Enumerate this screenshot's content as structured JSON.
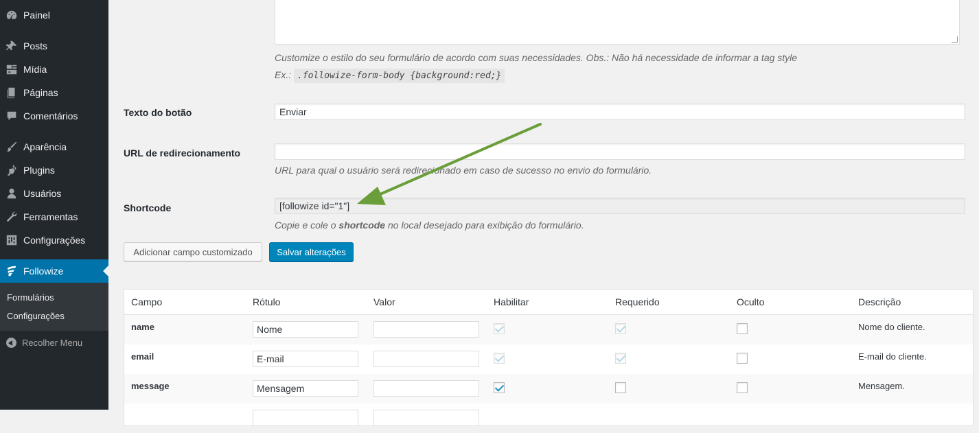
{
  "sidebar": {
    "menu": [
      {
        "label": "Painel",
        "icon": "dashboard-icon"
      },
      {
        "label": "Posts",
        "icon": "pin-icon"
      },
      {
        "label": "Mídia",
        "icon": "media-icon"
      },
      {
        "label": "Páginas",
        "icon": "pages-icon"
      },
      {
        "label": "Comentários",
        "icon": "comments-icon"
      },
      {
        "label": "Aparência",
        "icon": "brush-icon"
      },
      {
        "label": "Plugins",
        "icon": "plugin-icon"
      },
      {
        "label": "Usuários",
        "icon": "users-icon"
      },
      {
        "label": "Ferramentas",
        "icon": "wrench-icon"
      },
      {
        "label": "Configurações",
        "icon": "settings-icon"
      },
      {
        "label": "Followize",
        "icon": "followize-icon"
      }
    ],
    "submenu": [
      "Formulários",
      "Configurações"
    ],
    "collapse_label": "Recolher Menu",
    "accent_color": "#0073aa",
    "bg_color": "#23282d"
  },
  "form": {
    "css_help": "Customize o estilo do seu formulário de acordo com suas necessidades. Obs.: Não há necessidade de informar a tag style",
    "css_example_prefix": "Ex.:",
    "css_example_code": ".followize-form-body {background:red;}",
    "button_text_label": "Texto do botão",
    "button_text_value": "Enviar",
    "redirect_label": "URL de redirecionamento",
    "redirect_value": "",
    "redirect_help": "URL para qual o usuário será redirecionado em caso de sucesso no envio do formulário.",
    "shortcode_label": "Shortcode",
    "shortcode_value": "[followize id=\"1\"]",
    "shortcode_help_before": "Copie e cole o",
    "shortcode_help_bold": "shortcode",
    "shortcode_help_after": "no local desejado para exibição do formulário."
  },
  "buttons": {
    "add_custom_field": "Adicionar campo customizado",
    "save_changes": "Salvar alterações"
  },
  "table": {
    "headers": [
      "Campo",
      "Rótulo",
      "Valor",
      "Habilitar",
      "Requerido",
      "Oculto",
      "Descrição"
    ],
    "rows": [
      {
        "campo": "name",
        "rotulo": "Nome",
        "valor": "",
        "habilitar": true,
        "habilitar_disabled": true,
        "requerido": true,
        "requerido_disabled": true,
        "oculto": false,
        "descricao": "Nome do cliente."
      },
      {
        "campo": "email",
        "rotulo": "E-mail",
        "valor": "",
        "habilitar": true,
        "habilitar_disabled": true,
        "requerido": true,
        "requerido_disabled": true,
        "oculto": false,
        "descricao": "E-mail do cliente."
      },
      {
        "campo": "message",
        "rotulo": "Mensagem",
        "valor": "",
        "habilitar": true,
        "habilitar_disabled": false,
        "requerido": false,
        "requerido_disabled": false,
        "oculto": false,
        "descricao": "Mensagem."
      }
    ]
  },
  "annotation": {
    "arrow_color": "#6a9e3a"
  }
}
